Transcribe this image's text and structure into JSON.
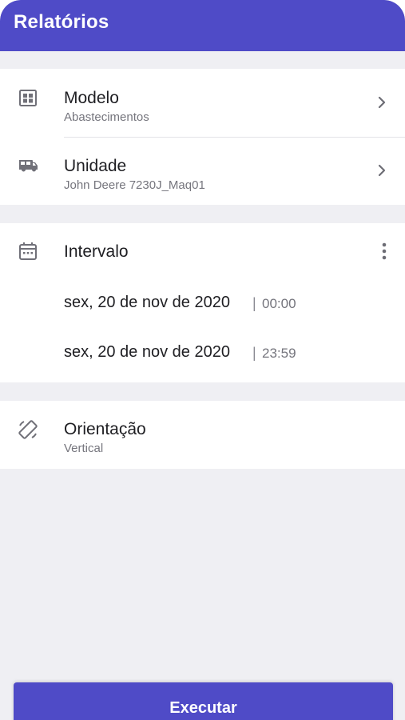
{
  "app_bar": {
    "title": "Relatórios"
  },
  "report": {
    "model": {
      "icon": "report-template-icon",
      "title": "Modelo",
      "value": "Abastecimentos"
    },
    "unit": {
      "icon": "vehicle-icon",
      "title": "Unidade",
      "value": "John Deere 7230J_Maq01"
    }
  },
  "interval": {
    "icon": "calendar-icon",
    "title": "Intervalo",
    "more_icon": "more-vertical-icon",
    "start": {
      "date": "sex, 20 de nov de 2020",
      "separator": "|",
      "time": "00:00"
    },
    "end": {
      "date": "sex, 20 de nov de 2020",
      "separator": "|",
      "time": "23:59"
    }
  },
  "orientation": {
    "icon": "screen-rotation-icon",
    "title": "Orientação",
    "value": "Vertical"
  },
  "actions": {
    "execute_label": "Executar"
  },
  "colors": {
    "primary": "#4f4bc7",
    "background": "#efeff3",
    "card": "#ffffff",
    "text_primary": "#1e1e22",
    "text_secondary": "#75757d"
  }
}
